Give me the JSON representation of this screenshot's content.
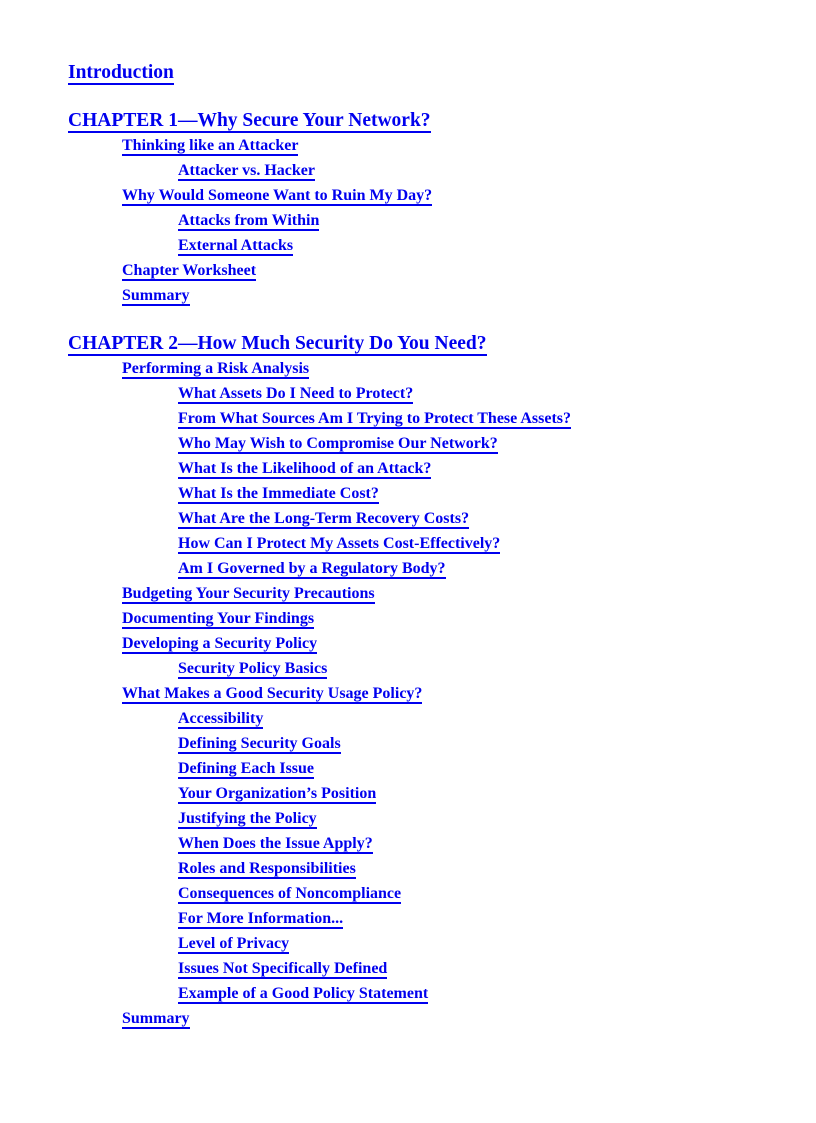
{
  "document": {
    "type": "table-of-contents",
    "link_color": "#0000EE",
    "background_color": "#FFFFFF",
    "entries": [
      {
        "label": "Introduction",
        "level": 0,
        "gap_before": false
      },
      {
        "label": "CHAPTER 1—Why Secure Your Network?",
        "level": 0,
        "gap_before": true
      },
      {
        "label": "Thinking like an Attacker",
        "level": 1,
        "gap_before": false
      },
      {
        "label": "Attacker vs. Hacker",
        "level": 2,
        "gap_before": false
      },
      {
        "label": "Why Would Someone Want to Ruin My Day?",
        "level": 1,
        "gap_before": false
      },
      {
        "label": "Attacks from Within",
        "level": 2,
        "gap_before": false
      },
      {
        "label": "External Attacks",
        "level": 2,
        "gap_before": false
      },
      {
        "label": "Chapter Worksheet",
        "level": 1,
        "gap_before": false
      },
      {
        "label": "Summary",
        "level": 1,
        "gap_before": false
      },
      {
        "label": "CHAPTER 2—How Much Security Do You Need?",
        "level": 0,
        "gap_before": true
      },
      {
        "label": "Performing a Risk Analysis",
        "level": 1,
        "gap_before": false
      },
      {
        "label": "What Assets Do I Need to Protect?",
        "level": 2,
        "gap_before": false
      },
      {
        "label": "From What Sources Am I Trying to Protect These Assets?",
        "level": 2,
        "gap_before": false
      },
      {
        "label": "Who May Wish to Compromise Our Network?",
        "level": 2,
        "gap_before": false
      },
      {
        "label": "What Is the Likelihood of an Attack?",
        "level": 2,
        "gap_before": false
      },
      {
        "label": "What Is the Immediate Cost?",
        "level": 2,
        "gap_before": false
      },
      {
        "label": "What Are the Long-Term Recovery Costs?",
        "level": 2,
        "gap_before": false
      },
      {
        "label": "How Can I Protect My Assets Cost-Effectively?",
        "level": 2,
        "gap_before": false
      },
      {
        "label": "Am I Governed by a Regulatory Body?",
        "level": 2,
        "gap_before": false
      },
      {
        "label": "Budgeting Your Security Precautions",
        "level": 1,
        "gap_before": false
      },
      {
        "label": "Documenting Your Findings",
        "level": 1,
        "gap_before": false
      },
      {
        "label": "Developing a Security Policy",
        "level": 1,
        "gap_before": false
      },
      {
        "label": "Security Policy Basics",
        "level": 2,
        "gap_before": false
      },
      {
        "label": "What Makes a Good Security Usage Policy?",
        "level": 1,
        "gap_before": false
      },
      {
        "label": "Accessibility",
        "level": 2,
        "gap_before": false
      },
      {
        "label": "Defining Security Goals",
        "level": 2,
        "gap_before": false
      },
      {
        "label": "Defining Each Issue",
        "level": 2,
        "gap_before": false
      },
      {
        "label": "Your Organization’s Position",
        "level": 2,
        "gap_before": false
      },
      {
        "label": "Justifying the Policy",
        "level": 2,
        "gap_before": false
      },
      {
        "label": "When Does the Issue Apply?",
        "level": 2,
        "gap_before": false
      },
      {
        "label": "Roles and Responsibilities",
        "level": 2,
        "gap_before": false
      },
      {
        "label": "Consequences of Noncompliance",
        "level": 2,
        "gap_before": false
      },
      {
        "label": "For More Information...",
        "level": 2,
        "gap_before": false
      },
      {
        "label": "Level of Privacy",
        "level": 2,
        "gap_before": false
      },
      {
        "label": "Issues Not Specifically Defined",
        "level": 2,
        "gap_before": false
      },
      {
        "label": "Example of a Good Policy Statement",
        "level": 2,
        "gap_before": false
      },
      {
        "label": "Summary",
        "level": 1,
        "gap_before": false
      }
    ]
  }
}
